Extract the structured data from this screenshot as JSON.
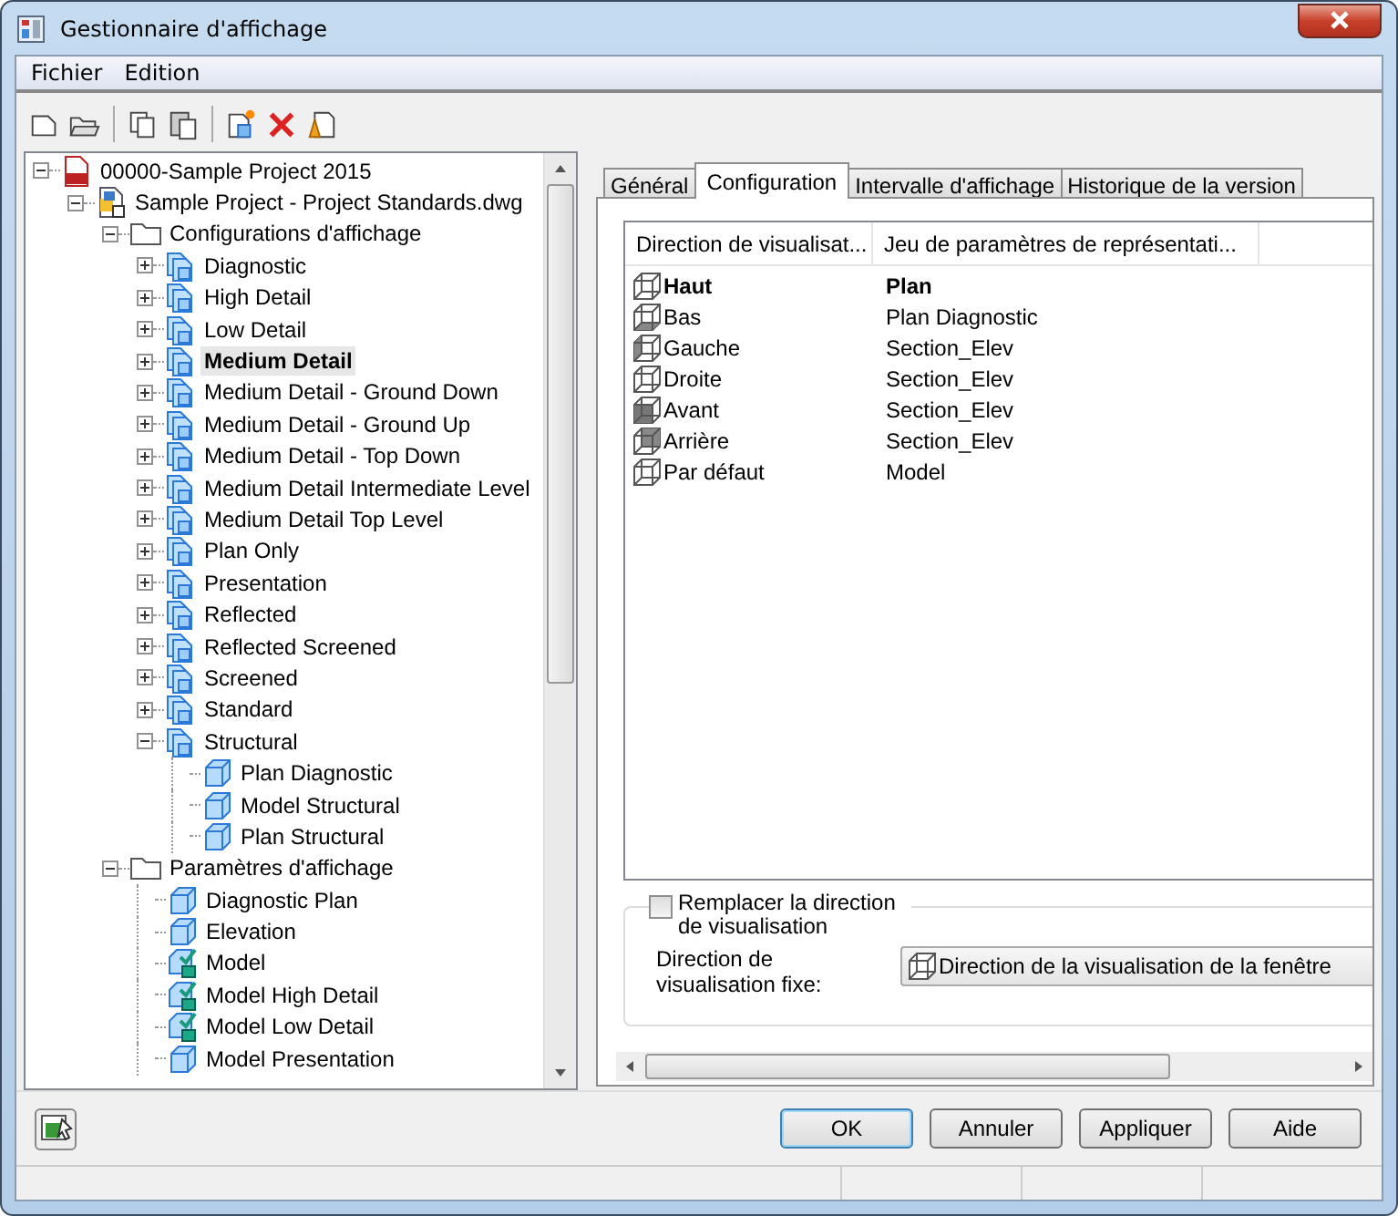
{
  "window": {
    "title": "Gestionnaire d'affichage"
  },
  "menu": [
    {
      "label": "Fichier"
    },
    {
      "label": "Edition"
    }
  ],
  "tree": [
    {
      "label": "00000-Sample Project 2015",
      "kind": "project",
      "expanded": true,
      "selected": false,
      "children": [
        {
          "label": "Sample Project - Project Standards.dwg",
          "kind": "drawing",
          "expanded": true,
          "selected": false,
          "children": [
            {
              "label": "Configurations d'affichage",
              "kind": "folder",
              "expanded": true,
              "selected": false,
              "children": [
                {
                  "label": "Diagnostic",
                  "kind": "configuration",
                  "expanded": false,
                  "selected": false
                },
                {
                  "label": "High Detail",
                  "kind": "configuration",
                  "expanded": false,
                  "selected": false
                },
                {
                  "label": "Low Detail",
                  "kind": "configuration",
                  "expanded": false,
                  "selected": false
                },
                {
                  "label": "Medium Detail",
                  "kind": "configuration",
                  "expanded": false,
                  "selected": true
                },
                {
                  "label": "Medium Detail - Ground Down",
                  "kind": "configuration",
                  "expanded": false,
                  "selected": false
                },
                {
                  "label": "Medium Detail - Ground Up",
                  "kind": "configuration",
                  "expanded": false,
                  "selected": false
                },
                {
                  "label": "Medium Detail - Top Down",
                  "kind": "configuration",
                  "expanded": false,
                  "selected": false
                },
                {
                  "label": "Medium Detail Intermediate Level",
                  "kind": "configuration",
                  "expanded": false,
                  "selected": false
                },
                {
                  "label": "Medium Detail Top Level",
                  "kind": "configuration",
                  "expanded": false,
                  "selected": false
                },
                {
                  "label": "Plan Only",
                  "kind": "configuration",
                  "expanded": false,
                  "selected": false
                },
                {
                  "label": "Presentation",
                  "kind": "configuration",
                  "expanded": false,
                  "selected": false
                },
                {
                  "label": "Reflected",
                  "kind": "configuration",
                  "expanded": false,
                  "selected": false
                },
                {
                  "label": "Reflected Screened",
                  "kind": "configuration",
                  "expanded": false,
                  "selected": false
                },
                {
                  "label": "Screened",
                  "kind": "configuration",
                  "expanded": false,
                  "selected": false
                },
                {
                  "label": "Standard",
                  "kind": "configuration",
                  "expanded": false,
                  "selected": false
                },
                {
                  "label": "Structural",
                  "kind": "configuration",
                  "expanded": true,
                  "selected": false,
                  "children": [
                    {
                      "label": "Plan Diagnostic",
                      "kind": "set",
                      "selected": false
                    },
                    {
                      "label": "Model Structural",
                      "kind": "set",
                      "selected": false
                    },
                    {
                      "label": "Plan Structural",
                      "kind": "set",
                      "selected": false
                    }
                  ]
                }
              ]
            },
            {
              "label": "Paramètres d'affichage",
              "kind": "folder",
              "expanded": true,
              "selected": false,
              "children": [
                {
                  "label": "Diagnostic Plan",
                  "kind": "set",
                  "selected": false
                },
                {
                  "label": "Elevation",
                  "kind": "set",
                  "selected": false
                },
                {
                  "label": "Model",
                  "kind": "set-checked",
                  "selected": false
                },
                {
                  "label": "Model High Detail",
                  "kind": "set-checked",
                  "selected": false
                },
                {
                  "label": "Model Low Detail",
                  "kind": "set-checked",
                  "selected": false
                },
                {
                  "label": "Model Presentation",
                  "kind": "set",
                  "selected": false
                }
              ]
            }
          ]
        }
      ]
    }
  ],
  "tabs": [
    {
      "label": "Général",
      "selected": false
    },
    {
      "label": "Configuration",
      "selected": true
    },
    {
      "label": "Intervalle d'affichage",
      "selected": false
    },
    {
      "label": "Historique de la version",
      "selected": false
    }
  ],
  "table": {
    "columns": [
      "Direction de visualisat...",
      "Jeu de paramètres de représentati..."
    ],
    "rows": [
      {
        "direction": "Haut",
        "set": "Plan",
        "current": true
      },
      {
        "direction": "Bas",
        "set": "Plan Diagnostic",
        "current": false
      },
      {
        "direction": "Gauche",
        "set": "Section_Elev",
        "current": false
      },
      {
        "direction": "Droite",
        "set": "Section_Elev",
        "current": false
      },
      {
        "direction": "Avant",
        "set": "Section_Elev",
        "current": false
      },
      {
        "direction": "Arrière",
        "set": "Section_Elev",
        "current": false
      },
      {
        "direction": "Par défaut",
        "set": "Model",
        "current": false
      }
    ]
  },
  "override": {
    "label": "Remplacer la direction de visualisation",
    "checked": false,
    "field_label": "Direction de visualisation fixe:",
    "value": "Direction de la visualisation de la fenêtre"
  },
  "buttons": [
    {
      "label": "OK",
      "default": true
    },
    {
      "label": "Annuler",
      "default": false
    },
    {
      "label": "Appliquer",
      "default": false
    },
    {
      "label": "Aide",
      "default": false
    }
  ]
}
